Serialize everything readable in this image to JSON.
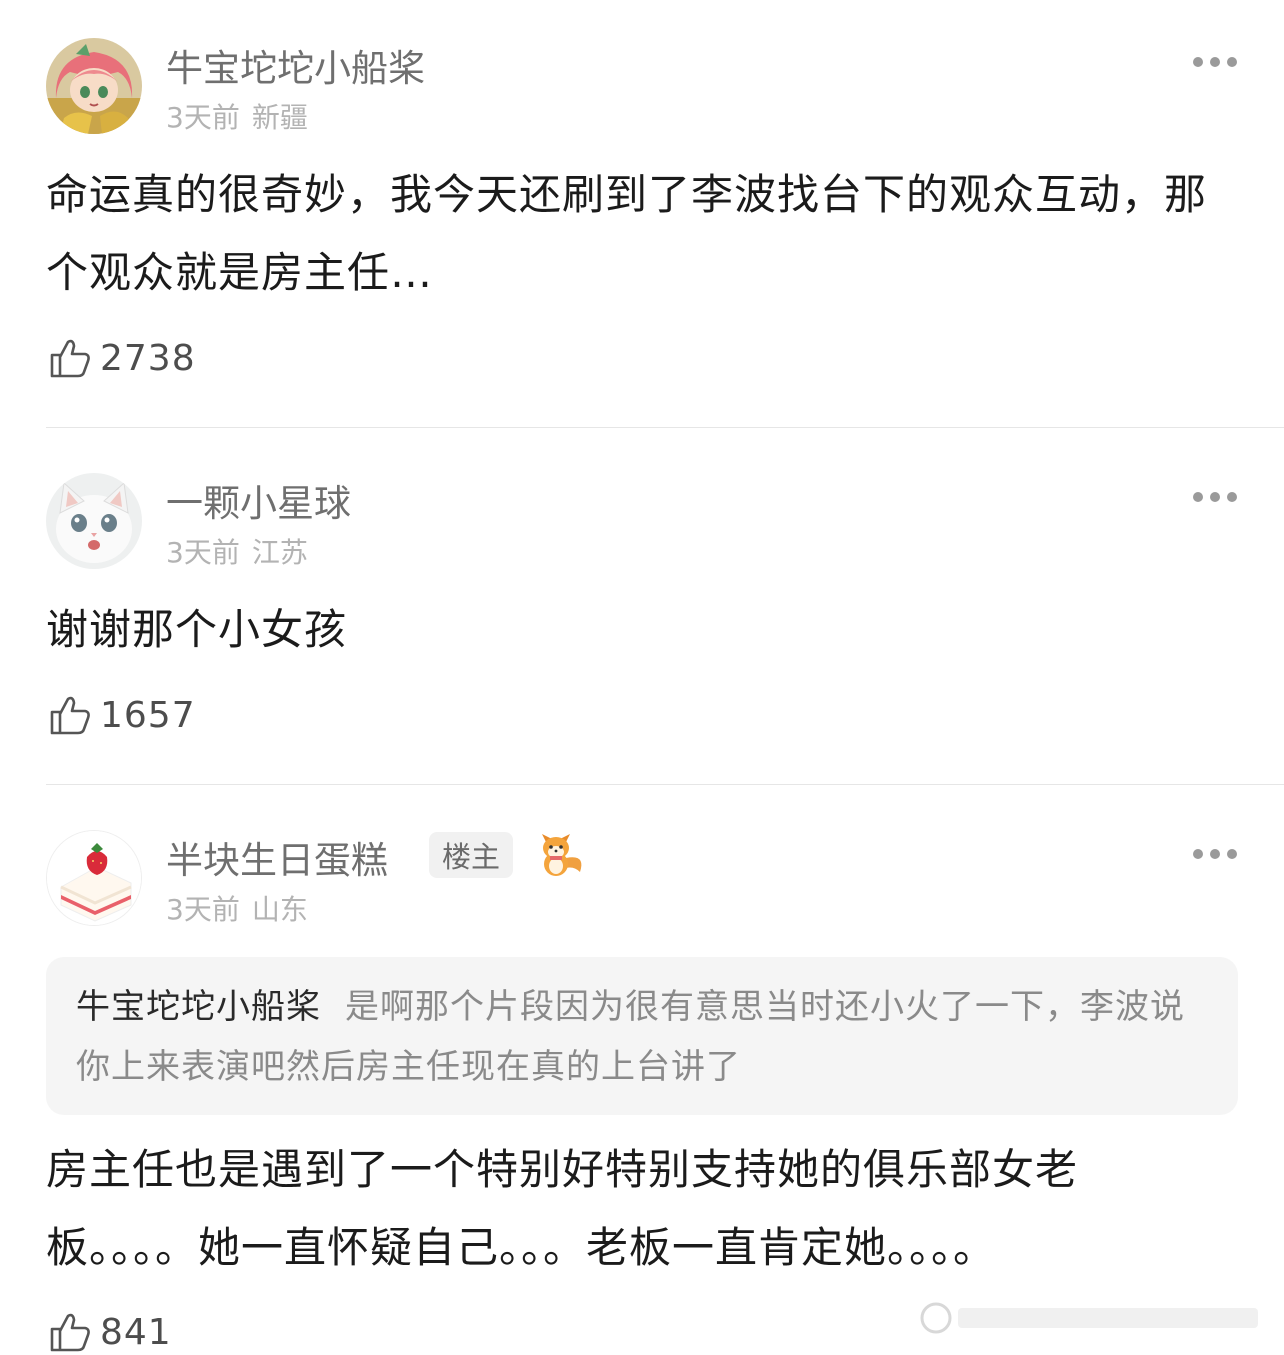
{
  "comments": [
    {
      "author": "牛宝坨坨小船桨",
      "time": "3天前",
      "location": "新疆",
      "text": "命运真的很奇妙，我今天还刷到了李波找台下的观众互动，那个观众就是房主任…",
      "likes": "2738",
      "avatar_icon": "anime-girl-avatar"
    },
    {
      "author": "一颗小星球",
      "time": "3天前",
      "location": "江苏",
      "text": "谢谢那个小女孩",
      "likes": "1657",
      "avatar_icon": "white-cat-avatar"
    },
    {
      "author": "半块生日蛋糕",
      "badge": "楼主",
      "time": "3天前",
      "location": "山东",
      "quote": {
        "author": "牛宝坨坨小船桨",
        "text": "是啊那个片段因为很有意思当时还小火了一下，李波说你上来表演吧然后房主任现在真的上台讲了"
      },
      "text": "房主任也是遇到了一个特别好特别支持她的俱乐部女老板。。。。她一直怀疑自己。。。老板一直肯定她。。。。",
      "likes": "841",
      "avatar_icon": "strawberry-cake-avatar"
    }
  ],
  "icons": {
    "like": "thumbs-up-icon",
    "more": "more-dots-icon",
    "fox": "fox-sticker-icon"
  },
  "colors": {
    "name": "#6f6f6f",
    "meta": "#b3b3b3",
    "body_text": "#1b1b1b",
    "quote_bg": "#f5f5f5",
    "divider": "#e6e6e6"
  }
}
